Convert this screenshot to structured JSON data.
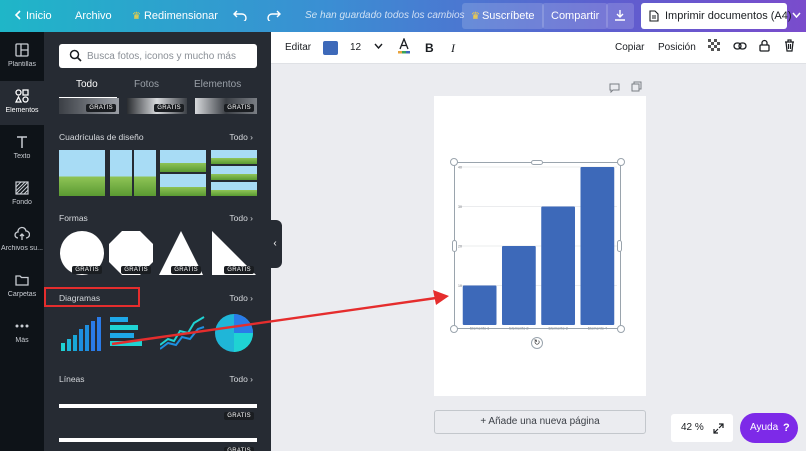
{
  "topbar": {
    "home": "Inicio",
    "file": "Archivo",
    "resize": "Redimensionar",
    "saved_status": "Se han guardado todos los cambios",
    "subscribe": "Suscríbete",
    "share": "Compartir",
    "print": "Imprimir documentos (A4)"
  },
  "rail": {
    "templates": "Plantillas",
    "elements": "Elementos",
    "text": "Texto",
    "background": "Fondo",
    "uploads": "Archivos su...",
    "folders": "Carpetas",
    "more": "Más"
  },
  "panel": {
    "search_placeholder": "Busca fotos, iconos y mucho más",
    "tabs": [
      "Todo",
      "Fotos",
      "Elementos"
    ],
    "badge": "GRATIS",
    "see_all": "Todo",
    "sections": {
      "grids": "Cuadrículas de diseño",
      "shapes": "Formas",
      "charts": "Diagramas",
      "lines": "Líneas"
    }
  },
  "toolbar": {
    "edit": "Editar",
    "color": "#3d69b9",
    "font_size": "12",
    "copy": "Copiar",
    "position": "Posición"
  },
  "chart_data": {
    "type": "bar",
    "categories": [
      "Elemento 1",
      "Elemento 2",
      "Elemento 3",
      "Elemento 4"
    ],
    "values": [
      10,
      20,
      30,
      40
    ],
    "ylim": [
      0,
      40
    ],
    "yticks": [
      10,
      20,
      30,
      40
    ],
    "color": "#3d69b9",
    "grid": true,
    "title": "",
    "xlabel": "",
    "ylabel": ""
  },
  "footer": {
    "add_page": "+ Añade una nueva página",
    "zoom": "42 %",
    "help": "Ayuda",
    "help_mark": "?"
  },
  "colors": {
    "accent_purple": "#7d2ae8",
    "highlight_red": "#e52d2d"
  }
}
